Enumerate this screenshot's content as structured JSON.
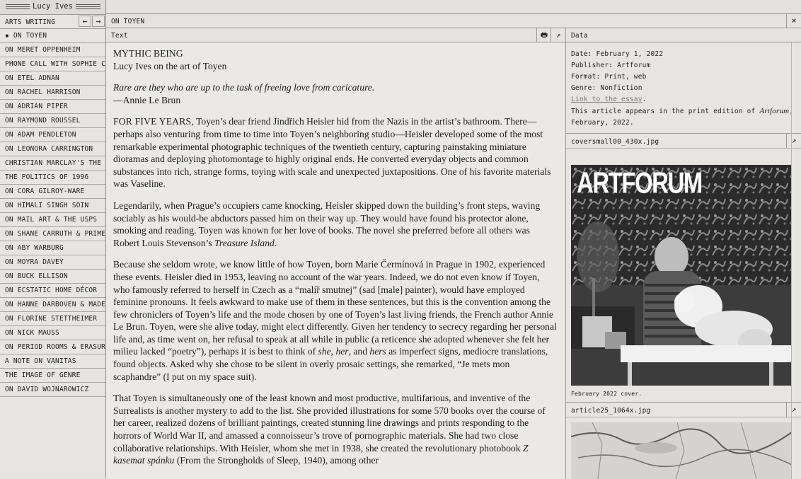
{
  "left_window": {
    "title": "Lucy Ives",
    "series_title": "ARTS WRITING",
    "prev_glyph": "←",
    "next_glyph": "→",
    "items": [
      "▪ ON TOYEN",
      "ON MERET OPPENHEIM",
      "PHONE CALL WITH SOPHIE C",
      "ON ETEL ADNAN",
      "ON RACHEL HARRISON",
      "ON ADRIAN PIPER",
      "ON RAYMOND ROUSSEL",
      "ON ADAM PENDLETON",
      "ON LEONORA CARRINGTON",
      "CHRISTIAN MARCLAY'S THE",
      "THE POLITICS OF 1996",
      "ON CORA GILROY-WARE",
      "ON HIMALI SINGH SOIN",
      "ON MAIL ART & THE USPS",
      "ON SHANE CARRUTH & PRIME",
      "ON ABY WARBURG",
      "ON MOYRA DAVEY",
      "ON BUCK ELLISON",
      "ON ECSTATIC HOME DÉCOR",
      "ON HANNE DARBOVEN & MADE",
      "ON FLORINE STETTHEIMER",
      "ON NICK MAUSS",
      "ON PERIOD ROOMS & ERASUR",
      "A NOTE ON VANITAS",
      "THE IMAGE OF GENRE",
      "ON DAVID WOJNAROWICZ"
    ]
  },
  "right_window": {
    "title": "ON TOYEN",
    "close_glyph": "×",
    "text_pane": {
      "label": "Text",
      "print_glyph": "🖶",
      "popout_glyph": "↗",
      "heading": "MYTHIC BEING",
      "subheading": "Lucy Ives on the art of Toyen",
      "epigraph": "Rare are they who are up to the task of freeing love from caricature.",
      "epigraph_attribution": "—Annie Le Brun",
      "p1_lead": "FOR FIVE YEARS,",
      "p1_rest": " Toyen’s dear friend Jindřich Heisler hid from the Nazis in the artist’s bathroom. There—perhaps also venturing from time to time into Toyen’s neighboring studio—Heisler developed some of the most remarkable experimental photographic techniques of the twentieth century, capturing painstaking miniature dioramas and deploying photomontage to highly original ends. He converted everyday objects and common substances into rich, strange forms, toying with scale and unexpected juxtapositions. One of his favorite materials was Vaseline.",
      "p2_text": "Legendarily, when Prague’s occupiers came knocking, Heisler skipped down the building’s front steps, waving sociably as his would-be abductors passed him on their way up. They would have found his protector alone, smoking and reading. Toyen was known for her love of books. The novel she preferred before all others was Robert Louis Stevenson’s ",
      "p2_book": "Treasure Island",
      "p2_end": ".",
      "p3_a": "Because she seldom wrote, we know little of how Toyen, born Marie Čermínová in Prague in 1902, experienced these events. Heisler died in 1953, leaving no account of the war years. Indeed, we do not even know if Toyen, who famously referred to herself in Czech as a “malíř smutnej” (sad [male] painter), would have employed feminine pronouns. It feels awkward to make use of them in these sentences, but this is the convention among the few chroniclers of Toyen’s life and the mode chosen by one of Toyen’s last living friends, the French author Annie Le Brun. Toyen, were she alive today, might elect differently. Given her tendency to secrecy regarding her personal life and, as time went on, her refusal to speak at all while in public (a reticence she adopted whenever she felt her milieu lacked “poetry”), perhaps it is best to think of ",
      "p3_she": "she",
      "p3_comma": ", ",
      "p3_her": "her",
      "p3_and": ", and ",
      "p3_hers": "hers",
      "p3_b": " as imperfect signs, mediocre translations, found objects. Asked why she chose to be silent in overly prosaic settings, she remarked, “Je mets mon scaphandre” (I put on my space suit).",
      "p4_a": "That Toyen is simultaneously one of the least known and most productive, multifarious, and inventive of the Surrealists is another mystery to add to the list. She provided illustrations for some 570 books over the course of her career, realized dozens of brilliant paintings, created stunning line drawings and prints responding to the horrors of World War II, and amassed a connoisseur’s trove of pornographic materials. She had two close collaborative relationships. With Heisler, whom she met in 1938, she created the revolutionary photobook ",
      "p4_book": "Z kasemat spánku",
      "p4_b": " (From the Strongholds of Sleep, 1940), among other"
    },
    "data_pane": {
      "label": "Data",
      "date": "Date: February 1, 2022",
      "publisher": "Publisher: Artforum",
      "format": "Format: Print, web",
      "genre": "Genre: Nonfiction",
      "link_text": "Link to the essay",
      "link_period": ".",
      "print_note_a": "This article appears in the print edition of ",
      "print_note_mag": "Artforum",
      "print_note_b": ", February, 2022.",
      "file1_name": "coversmall00_430x.jpg",
      "cover_masthead": "ARTFORUM",
      "file1_caption": "February 2022 cover.",
      "file2_name": "article25_1064x.jpg",
      "popout_glyph": "↗"
    }
  }
}
